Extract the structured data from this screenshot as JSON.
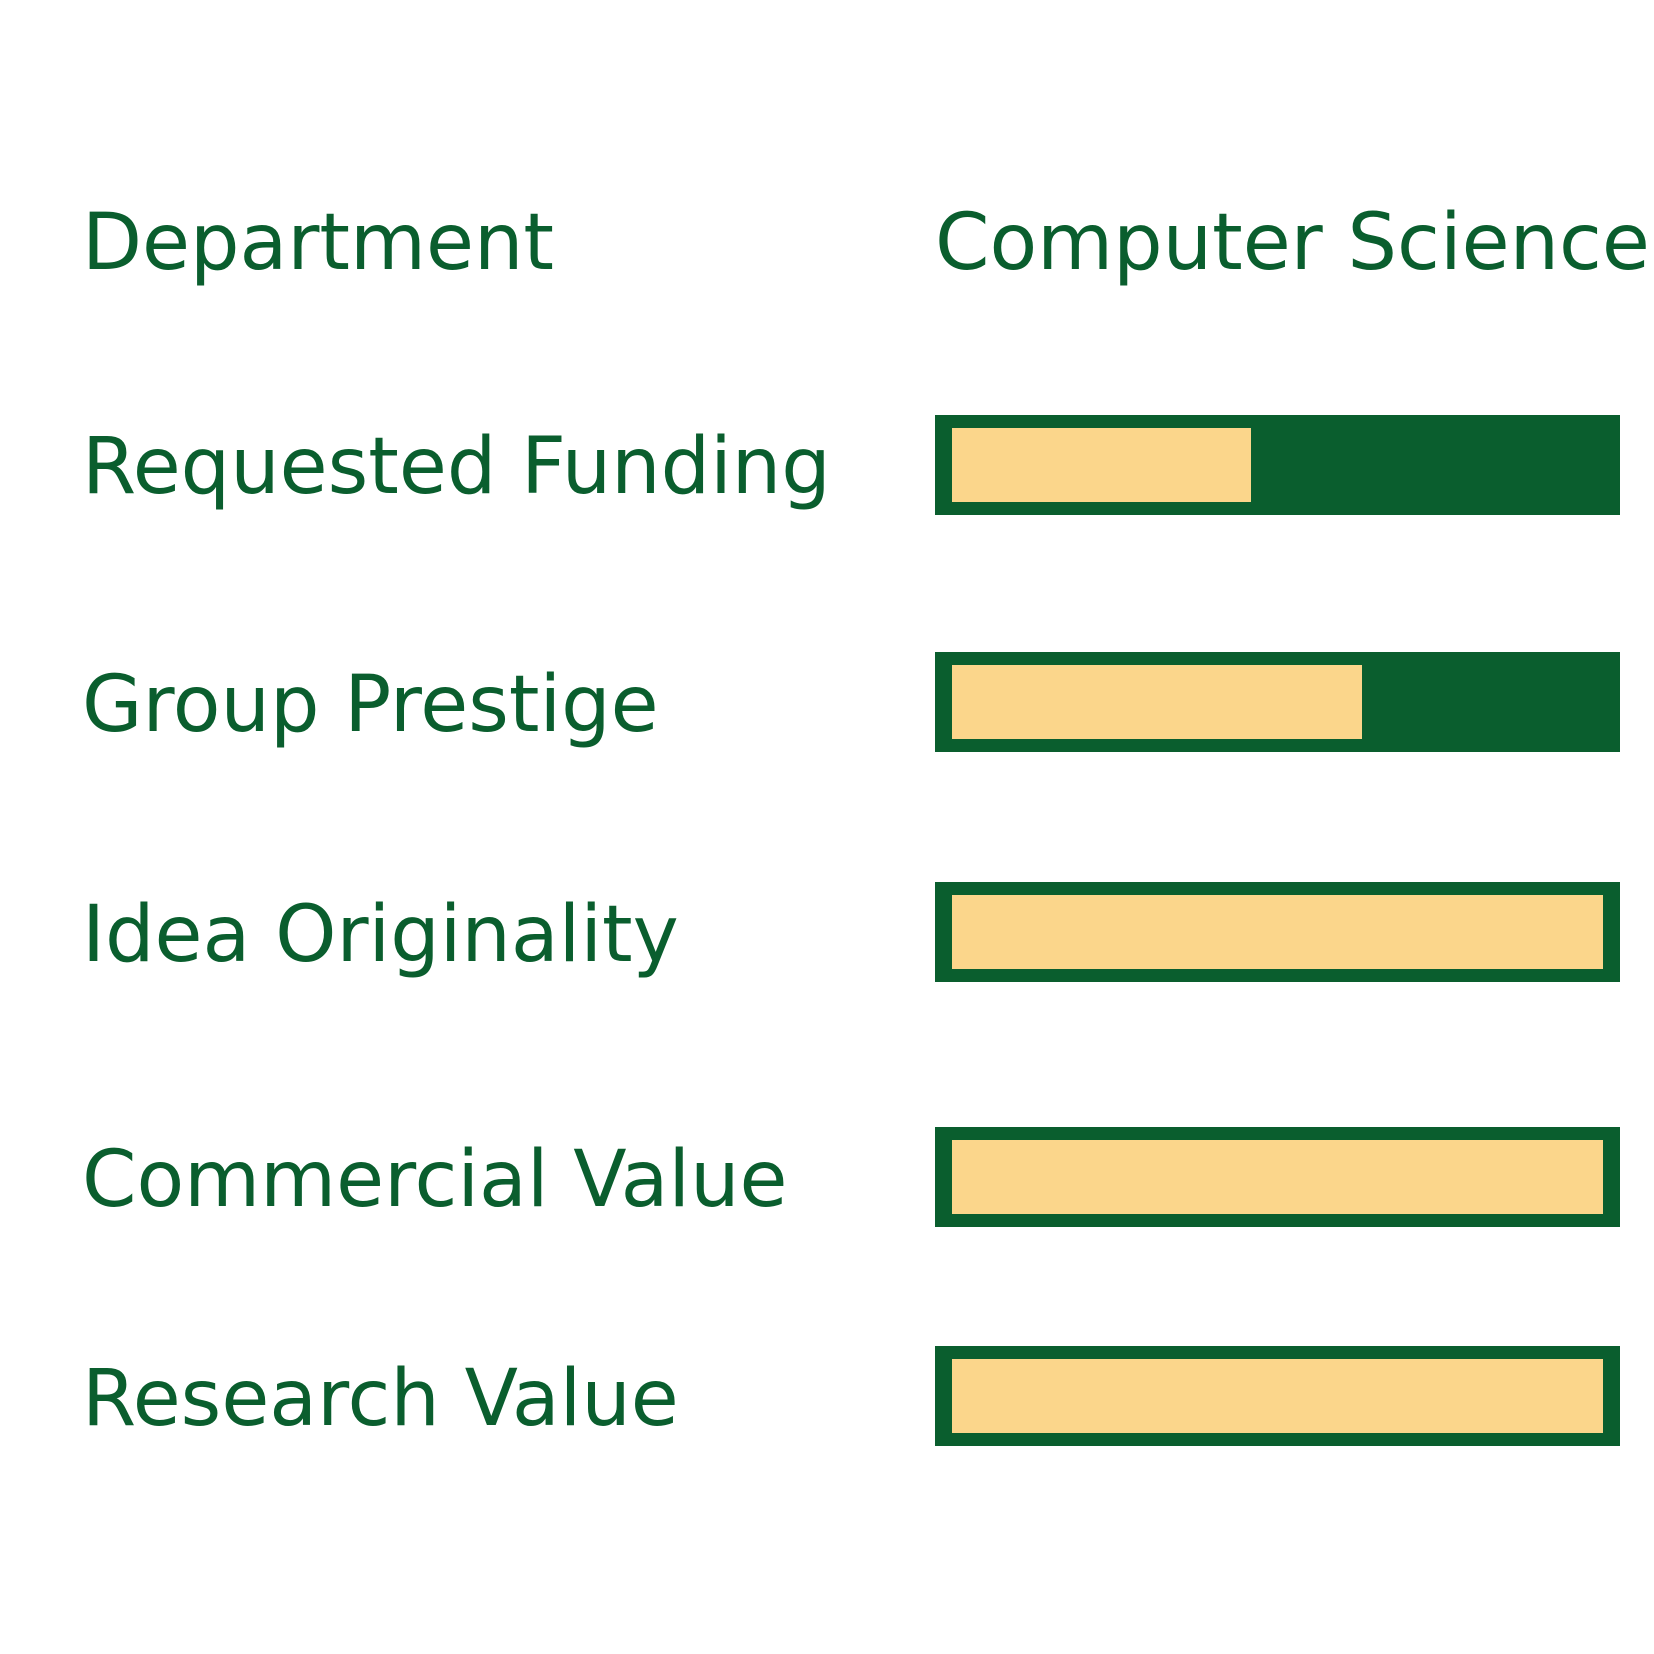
{
  "chart_data": {
    "type": "bar",
    "orientation": "horizontal",
    "header": {
      "label": "Department",
      "value": "Computer Science"
    },
    "categories": [
      "Requested Funding",
      "Group Prestige",
      "Idea Originality",
      "Commercial Value",
      "Research Value"
    ],
    "values": [
      0.46,
      0.63,
      1.0,
      1.0,
      1.0
    ],
    "xlim": [
      0,
      1
    ],
    "grid": false,
    "colors": {
      "text": "#0a5e2e",
      "track": "#0a5e2e",
      "fill": "#fbd68b",
      "background": "#ffffff"
    }
  }
}
